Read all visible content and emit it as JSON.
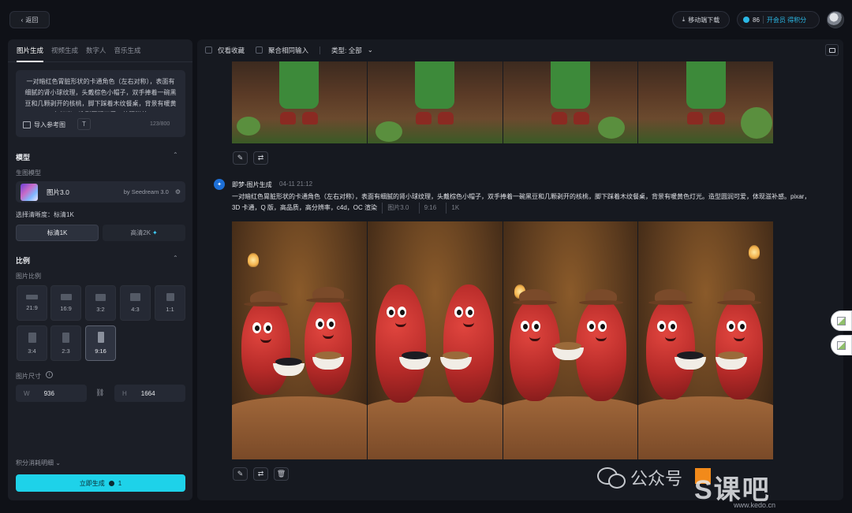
{
  "header": {
    "back_label": "返回",
    "mobile_label": "移动端下载",
    "credits": "86",
    "vip_label": "开会员 得积分"
  },
  "left": {
    "tabs": [
      {
        "label": "图片生成",
        "active": true
      },
      {
        "label": "视频生成",
        "active": false
      },
      {
        "label": "数字人",
        "active": false
      },
      {
        "label": "音乐生成",
        "active": false
      }
    ],
    "prompt_text": "一对暗红色胃脏形状的卡通角色（左右对称），表面有细腻的肾小球纹理，头戴棕色小帽子，双手捧着一碗黑豆和几颗剥开的核桃，脚下踩着木纹餐桌，背景有暖黄色灯光。造型圆润可爱，体现滋补",
    "ref_label": "导入参考图",
    "counter": "123/800",
    "model_section": "模型",
    "model_sublabel": "生图模型",
    "model_name": "图片3.0",
    "model_vendor": "by Seedream 3.0",
    "res_label": "选择清晰度：标清1K",
    "res_options": [
      {
        "label": "标清1K",
        "active": true
      },
      {
        "label": "高清2K",
        "active": false
      }
    ],
    "ratio_section": "比例",
    "ratio_sublabel": "图片比例",
    "ratios": [
      {
        "label": "21:9",
        "active": false
      },
      {
        "label": "16:9",
        "active": false
      },
      {
        "label": "3:2",
        "active": false
      },
      {
        "label": "4:3",
        "active": false
      },
      {
        "label": "1:1",
        "active": false
      },
      {
        "label": "3:4",
        "active": false
      },
      {
        "label": "2:3",
        "active": false
      },
      {
        "label": "9:16",
        "active": true
      }
    ],
    "size_label": "图片尺寸",
    "width_key": "W",
    "width_value": "936",
    "height_key": "H",
    "height_value": "1664",
    "cost_link": "积分消耗明细",
    "generate_label": "立即生成",
    "generate_cost": "1"
  },
  "main": {
    "toolbar": {
      "favorites_label": "仅看收藏",
      "merge_label": "聚合相同输入",
      "type_label": "类型: 全部"
    },
    "generation": {
      "title": "即梦-图片生成",
      "time": "04-11  21:12",
      "prompt": "一对暗红色胃脏形状的卡通角色（左右对称），表面有细腻的肾小球纹理，头戴棕色小帽子，双手捧着一碗黑豆和几颗剥开的核桃，脚下踩着木纹餐桌，背景有暖黄色灯光。造型圆润可爱，体现滋补感。pixar，3D 卡通，Q 版，高品质，高分辨率，c4d，OC 渲染",
      "tags": [
        "图片3.0",
        "9:16",
        "1K"
      ]
    }
  },
  "watermark": {
    "text": "公众号",
    "brand": "S课吧",
    "url": "www.kedo.cn"
  },
  "colors": {
    "accent": "#1ed2e9",
    "vip": "#2bb8e6",
    "panel": "#1b1e26"
  }
}
